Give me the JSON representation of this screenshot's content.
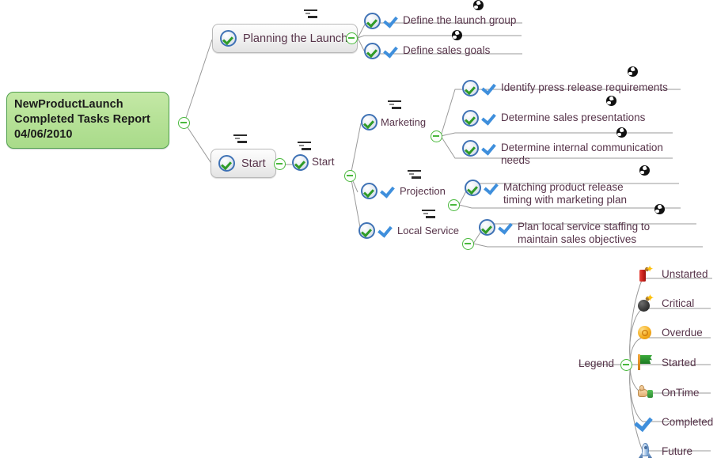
{
  "root": {
    "line1": "NewProductLaunch",
    "line2": "Completed Tasks Report",
    "line3": "04/06/2010",
    "fill_color": "#b7e298",
    "border_color": "#51a14e"
  },
  "branches": {
    "planning": {
      "label": "Planning the Launch",
      "children": [
        {
          "label": "Define the launch group"
        },
        {
          "label": "Define sales goals"
        }
      ]
    },
    "start_box": {
      "label": "Start"
    },
    "start_plain": {
      "label": "Start"
    },
    "marketing": {
      "label": "Marketing",
      "children": [
        {
          "label": "Identify press release requirements"
        },
        {
          "label": "Determine sales presentations"
        },
        {
          "label": "Determine internal communication needs"
        }
      ]
    },
    "projection": {
      "label": "Projection",
      "children": [
        {
          "label": "Matching product release timing with marketing plan"
        }
      ]
    },
    "local_service": {
      "label": "Local Service",
      "children": [
        {
          "label": "Plan local service staffing to maintain sales objectives"
        }
      ]
    }
  },
  "legend": {
    "label": "Legend",
    "items": [
      {
        "label": "Unstarted",
        "icon": "dynamite-icon",
        "color": "#c8201a"
      },
      {
        "label": "Critical",
        "icon": "bomb-icon",
        "color": "#3b3b3b"
      },
      {
        "label": "Overdue",
        "icon": "coin-icon",
        "color": "#f5ae21"
      },
      {
        "label": "Started",
        "icon": "flag-icon",
        "color": "#1d7a23"
      },
      {
        "label": "OnTime",
        "icon": "thumbs-up-icon",
        "color": "#e2ae72"
      },
      {
        "label": "Completed",
        "icon": "check-icon",
        "color": "#3f8fdc"
      },
      {
        "label": "Future",
        "icon": "rocket-icon",
        "color": "#6e9dd0"
      }
    ]
  },
  "theme": {
    "text_color": "#57344a",
    "wire_color": "#9a9a9a",
    "collapse_color": "#49b83c"
  }
}
